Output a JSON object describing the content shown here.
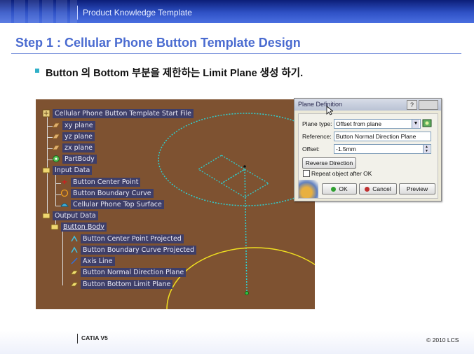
{
  "header": {
    "title": "Product Knowledge Template"
  },
  "slide": {
    "heading": "Step 1 : Cellular Phone Button Template Design",
    "bullet": "Button 의 Bottom 부분을 제한하는 Limit Plane 생성 하기."
  },
  "tree": {
    "root": "Cellular Phone Button Template Start File",
    "xy": "xy plane",
    "yz": "yz plane",
    "zx": "zx plane",
    "partbody": "PartBody",
    "input": "Input Data",
    "center": "Button Center Point",
    "boundary": "Button Boundary Curve",
    "surface": "Cellular Phone Top Surface",
    "output": "Output Data",
    "body": "Button Body",
    "center_proj": "Button Center Point Projected",
    "boundary_proj": "Button Boundary Curve Projected",
    "axis": "Axis Line",
    "normal": "Button Normal Direction Plane",
    "bottom": "Button Bottom Limit Plane"
  },
  "dialog": {
    "title": "Plane Definition",
    "help": "?",
    "plane_type_label": "Plane type:",
    "plane_type_value": "Offset from plane",
    "reference_label": "Reference:",
    "reference_value": "Button Normal Direction Plane",
    "offset_label": "Offset:",
    "offset_value": "-1.5mm",
    "reverse_label": "Reverse Direction",
    "repeat_label": "Repeat object after OK",
    "ok_label": "OK",
    "cancel_label": "Cancel",
    "preview_label": "Preview"
  },
  "footer": {
    "left": "CATIA V5",
    "right": "© 2010 LCS"
  },
  "colors": {
    "accent": "#4a6bd0",
    "viewport": "#7e5231",
    "tree_label": "#3e3e68",
    "curve": "#2fd0d0",
    "circle": "#f0e020"
  }
}
